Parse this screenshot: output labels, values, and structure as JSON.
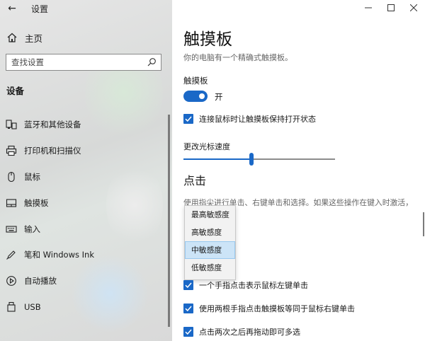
{
  "app": {
    "title": "设置"
  },
  "sidebar": {
    "home_label": "主页",
    "search_placeholder": "查找设置",
    "section_heading": "设备",
    "items": [
      {
        "label": "蓝牙和其他设备",
        "icon": "bluetooth-devices-icon"
      },
      {
        "label": "打印机和扫描仪",
        "icon": "printer-icon"
      },
      {
        "label": "鼠标",
        "icon": "mouse-icon"
      },
      {
        "label": "触摸板",
        "icon": "touchpad-icon"
      },
      {
        "label": "输入",
        "icon": "keyboard-icon"
      },
      {
        "label": "笔和 Windows Ink",
        "icon": "pen-icon"
      },
      {
        "label": "自动播放",
        "icon": "autoplay-icon"
      },
      {
        "label": "USB",
        "icon": "usb-icon"
      }
    ]
  },
  "main": {
    "title": "触摸板",
    "description": "你的电脑有一个精确式触摸板。",
    "toggle": {
      "label": "触摸板",
      "state_text": "开",
      "on": true
    },
    "keep_on_checkbox": {
      "label": "连接鼠标时让触摸板保持打开状态",
      "checked": true
    },
    "cursor_speed": {
      "label": "更改光标速度",
      "value_fraction": 0.45
    },
    "taps": {
      "title": "点击",
      "description": "使用指尖进行单击、右键单击和选择。如果这些操作在键入时激活，",
      "sensitivity_options": [
        "最高敏感度",
        "高敏感度",
        "中敏感度",
        "低敏感度"
      ],
      "selected_option": "中敏感度",
      "checkboxes": [
        {
          "label": "一个手指点击表示鼠标左键单击",
          "checked": true
        },
        {
          "label": "使用两根手指点击触摸板等同于鼠标右键单击",
          "checked": true
        },
        {
          "label": "点击两次之后再拖动即可多选",
          "checked": true
        }
      ]
    }
  },
  "colors": {
    "accent": "#1a68c7",
    "sidebar_bg": "#e3e3e3",
    "selected_option_bg": "#cce4f7"
  }
}
